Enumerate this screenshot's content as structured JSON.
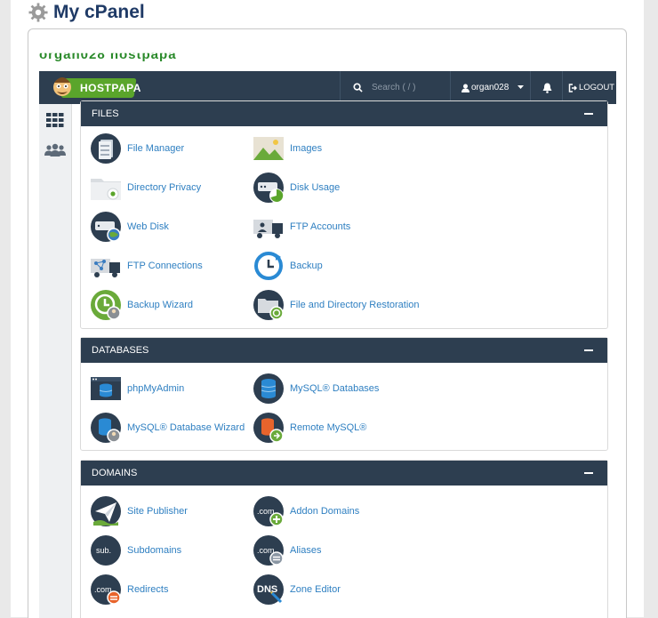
{
  "page": {
    "title": "My cPanel"
  },
  "garbled_text": "organ028 hostpapa",
  "topbar": {
    "brand": "HOSTPAPA",
    "search_placeholder": "Search ( / )",
    "username": "organ028",
    "logout_label": "LOGOUT"
  },
  "sidenav": {
    "items": [
      {
        "icon": "grid-icon"
      },
      {
        "icon": "users-icon"
      }
    ]
  },
  "panels": {
    "files": {
      "title": "FILES",
      "items": [
        {
          "label": "File Manager",
          "icon": "file-manager-icon"
        },
        {
          "label": "Images",
          "icon": "images-icon"
        },
        {
          "label": "Directory Privacy",
          "icon": "directory-privacy-icon"
        },
        {
          "label": "Disk Usage",
          "icon": "disk-usage-icon"
        },
        {
          "label": "Web Disk",
          "icon": "web-disk-icon"
        },
        {
          "label": "FTP Accounts",
          "icon": "ftp-accounts-icon"
        },
        {
          "label": "FTP Connections",
          "icon": "ftp-connections-icon"
        },
        {
          "label": "Backup",
          "icon": "backup-icon"
        },
        {
          "label": "Backup Wizard",
          "icon": "backup-wizard-icon"
        },
        {
          "label": "File and Directory Restoration",
          "icon": "file-restoration-icon"
        }
      ]
    },
    "databases": {
      "title": "DATABASES",
      "items": [
        {
          "label": "phpMyAdmin",
          "icon": "phpmyadmin-icon"
        },
        {
          "label": "MySQL® Databases",
          "icon": "mysql-databases-icon"
        },
        {
          "label": "MySQL® Database Wizard",
          "icon": "mysql-wizard-icon"
        },
        {
          "label": "Remote MySQL®",
          "icon": "remote-mysql-icon"
        }
      ]
    },
    "domains": {
      "title": "DOMAINS",
      "items": [
        {
          "label": "Site Publisher",
          "icon": "site-publisher-icon"
        },
        {
          "label": "Addon Domains",
          "icon": "addon-domains-icon"
        },
        {
          "label": "Subdomains",
          "icon": "subdomains-icon"
        },
        {
          "label": "Aliases",
          "icon": "aliases-icon"
        },
        {
          "label": "Redirects",
          "icon": "redirects-icon"
        },
        {
          "label": "Zone Editor",
          "icon": "zone-editor-icon"
        }
      ]
    }
  },
  "colors": {
    "navy": "#2d3e50",
    "link": "#2e7fc1",
    "title": "#1f3a66",
    "brand_green": "#5aa52b"
  }
}
